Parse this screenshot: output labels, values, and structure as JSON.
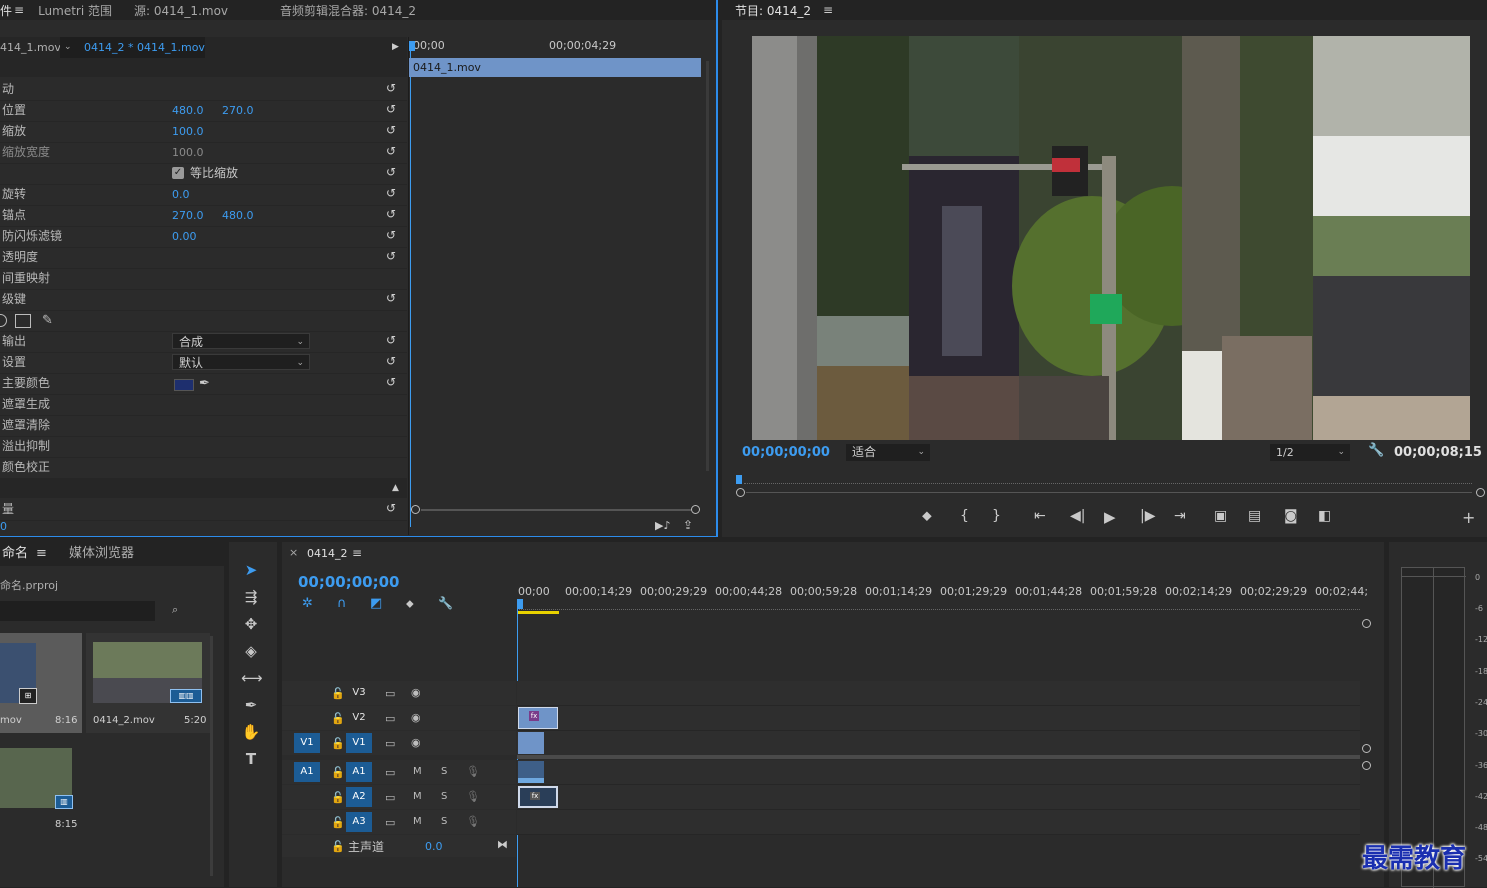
{
  "top_tabs": {
    "effect_controls_short": "件",
    "lumetri": "Lumetri 范围",
    "source": "源: 0414_1.mov",
    "audio_mixer": "音频剪辑混合器: 0414_2"
  },
  "effect_controls": {
    "clip_source": "414_1.mov",
    "clip_target": "0414_2 * 0414_1.mov",
    "timecode_start": "00;00",
    "timecode_end": "00;00;04;29",
    "clip_bar_label": "0414_1.mov",
    "rows": [
      {
        "label": "动"
      },
      {
        "label": "位置",
        "v1": "480.0",
        "v2": "270.0"
      },
      {
        "label": "缩放",
        "v1": "100.0"
      },
      {
        "label": "缩放宽度",
        "v1": "100.0"
      },
      {
        "label": "",
        "check_label": "等比缩放"
      },
      {
        "label": "旋转",
        "v1": "0.0"
      },
      {
        "label": "锚点",
        "v1": "270.0",
        "v2": "480.0"
      },
      {
        "label": "防闪烁滤镜",
        "v1": "0.00"
      },
      {
        "label": "透明度"
      },
      {
        "label": "间重映射"
      },
      {
        "label": "级键"
      },
      {
        "label": ""
      },
      {
        "label": "输出",
        "dropdown": "合成"
      },
      {
        "label": "设置",
        "dropdown": "默认"
      },
      {
        "label": "主要颜色"
      },
      {
        "label": "遮罩生成"
      },
      {
        "label": "遮罩清除"
      },
      {
        "label": "溢出抑制"
      },
      {
        "label": "颜色校正"
      }
    ],
    "bottom_label": "量",
    "bottom_value": "0"
  },
  "program_monitor": {
    "title": "节目: 0414_2",
    "timecode": "00;00;00;00",
    "fit_label": "适合",
    "resolution": "1/2",
    "duration": "00;00;08;15"
  },
  "project_panel": {
    "tab_project": "命名",
    "tab_media": "媒体浏览器",
    "project_file": "命名.prproj",
    "items": [
      {
        "name": "mov",
        "duration": "8:16"
      },
      {
        "name": "0414_2.mov",
        "duration": "5:20"
      },
      {
        "name": "",
        "duration": "8:15"
      }
    ]
  },
  "timeline": {
    "sequence_name": "0414_2",
    "timecode": "00;00;00;00",
    "ruler": [
      "00;00",
      "00;00;14;29",
      "00;00;29;29",
      "00;00;44;28",
      "00;00;59;28",
      "00;01;14;29",
      "00;01;29;29",
      "00;01;44;28",
      "00;01;59;28",
      "00;02;14;29",
      "00;02;29;29",
      "00;02;44;"
    ],
    "video_tracks": [
      "V3",
      "V2",
      "V1"
    ],
    "audio_tracks": [
      "A1",
      "A2",
      "A3"
    ],
    "source_v": "V1",
    "source_a": "A1",
    "master_label": "主声道",
    "master_value": "0.0",
    "mute": "M",
    "solo": "S"
  },
  "meter": {
    "labels": [
      "0",
      "-6",
      "-12",
      "-18",
      "-24",
      "-30",
      "-36",
      "-42",
      "-48",
      "-54"
    ]
  },
  "watermark": "最需教育",
  "colors": {
    "accent_blue": "#3d9cf0",
    "clip_blue": "#6f94c8",
    "track_active": "#1c5c95",
    "playhead_yellow": "#e8d200"
  }
}
